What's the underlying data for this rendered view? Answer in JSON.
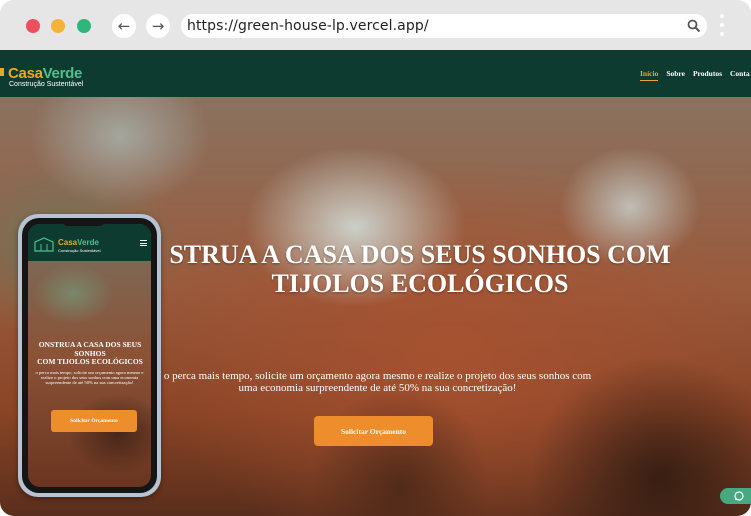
{
  "browser": {
    "url": "https://green-house-lp.vercel.app/",
    "back_icon": "arrow-left-icon",
    "forward_icon": "arrow-right-icon",
    "search_icon": "search-icon",
    "menu_icon": "kebab-menu-icon"
  },
  "site": {
    "logo": {
      "casa": "Casa",
      "verde": "Verde",
      "tagline": "Construção Sustentável"
    },
    "nav": [
      {
        "label": "Início",
        "active": true
      },
      {
        "label": "Sobre",
        "active": false
      },
      {
        "label": "Produtos",
        "active": false
      },
      {
        "label": "Conta",
        "active": false
      }
    ],
    "hero": {
      "title_line1": "STRUA A CASA DOS SEUS SONHOS COM",
      "title_line2": "TIJOLOS ECOLÓGICOS",
      "text_line1": "o perca mais tempo, solicite um orçamento agora mesmo e realize o projeto dos seus sonhos com",
      "text_line2": "uma economia surpreendente de até 50% na sua concretização!",
      "cta_label": "Solicitar Orçamento"
    },
    "whatsapp_icon": "whatsapp-icon"
  },
  "phone": {
    "logo": {
      "casa": "Casa",
      "verde": "Verde",
      "tagline": "Construção Sustentável"
    },
    "title_line1": "ONSTRUA A CASA DOS SEUS SONHOS",
    "title_line2": "COM TIJOLOS ECOLÓGICOS",
    "text": "o perca mais tempo, solicite um orçamento agora mesmo e realize o projeto dos seus sonhos com uma economia surpreendente de até 50% na sua concretização!",
    "cta_label": "Solicitar Orçamento"
  },
  "colors": {
    "header_green": "#0e3b30",
    "accent_orange": "#ee8d2b",
    "logo_gold": "#e9a825",
    "logo_green": "#4fc08d"
  }
}
